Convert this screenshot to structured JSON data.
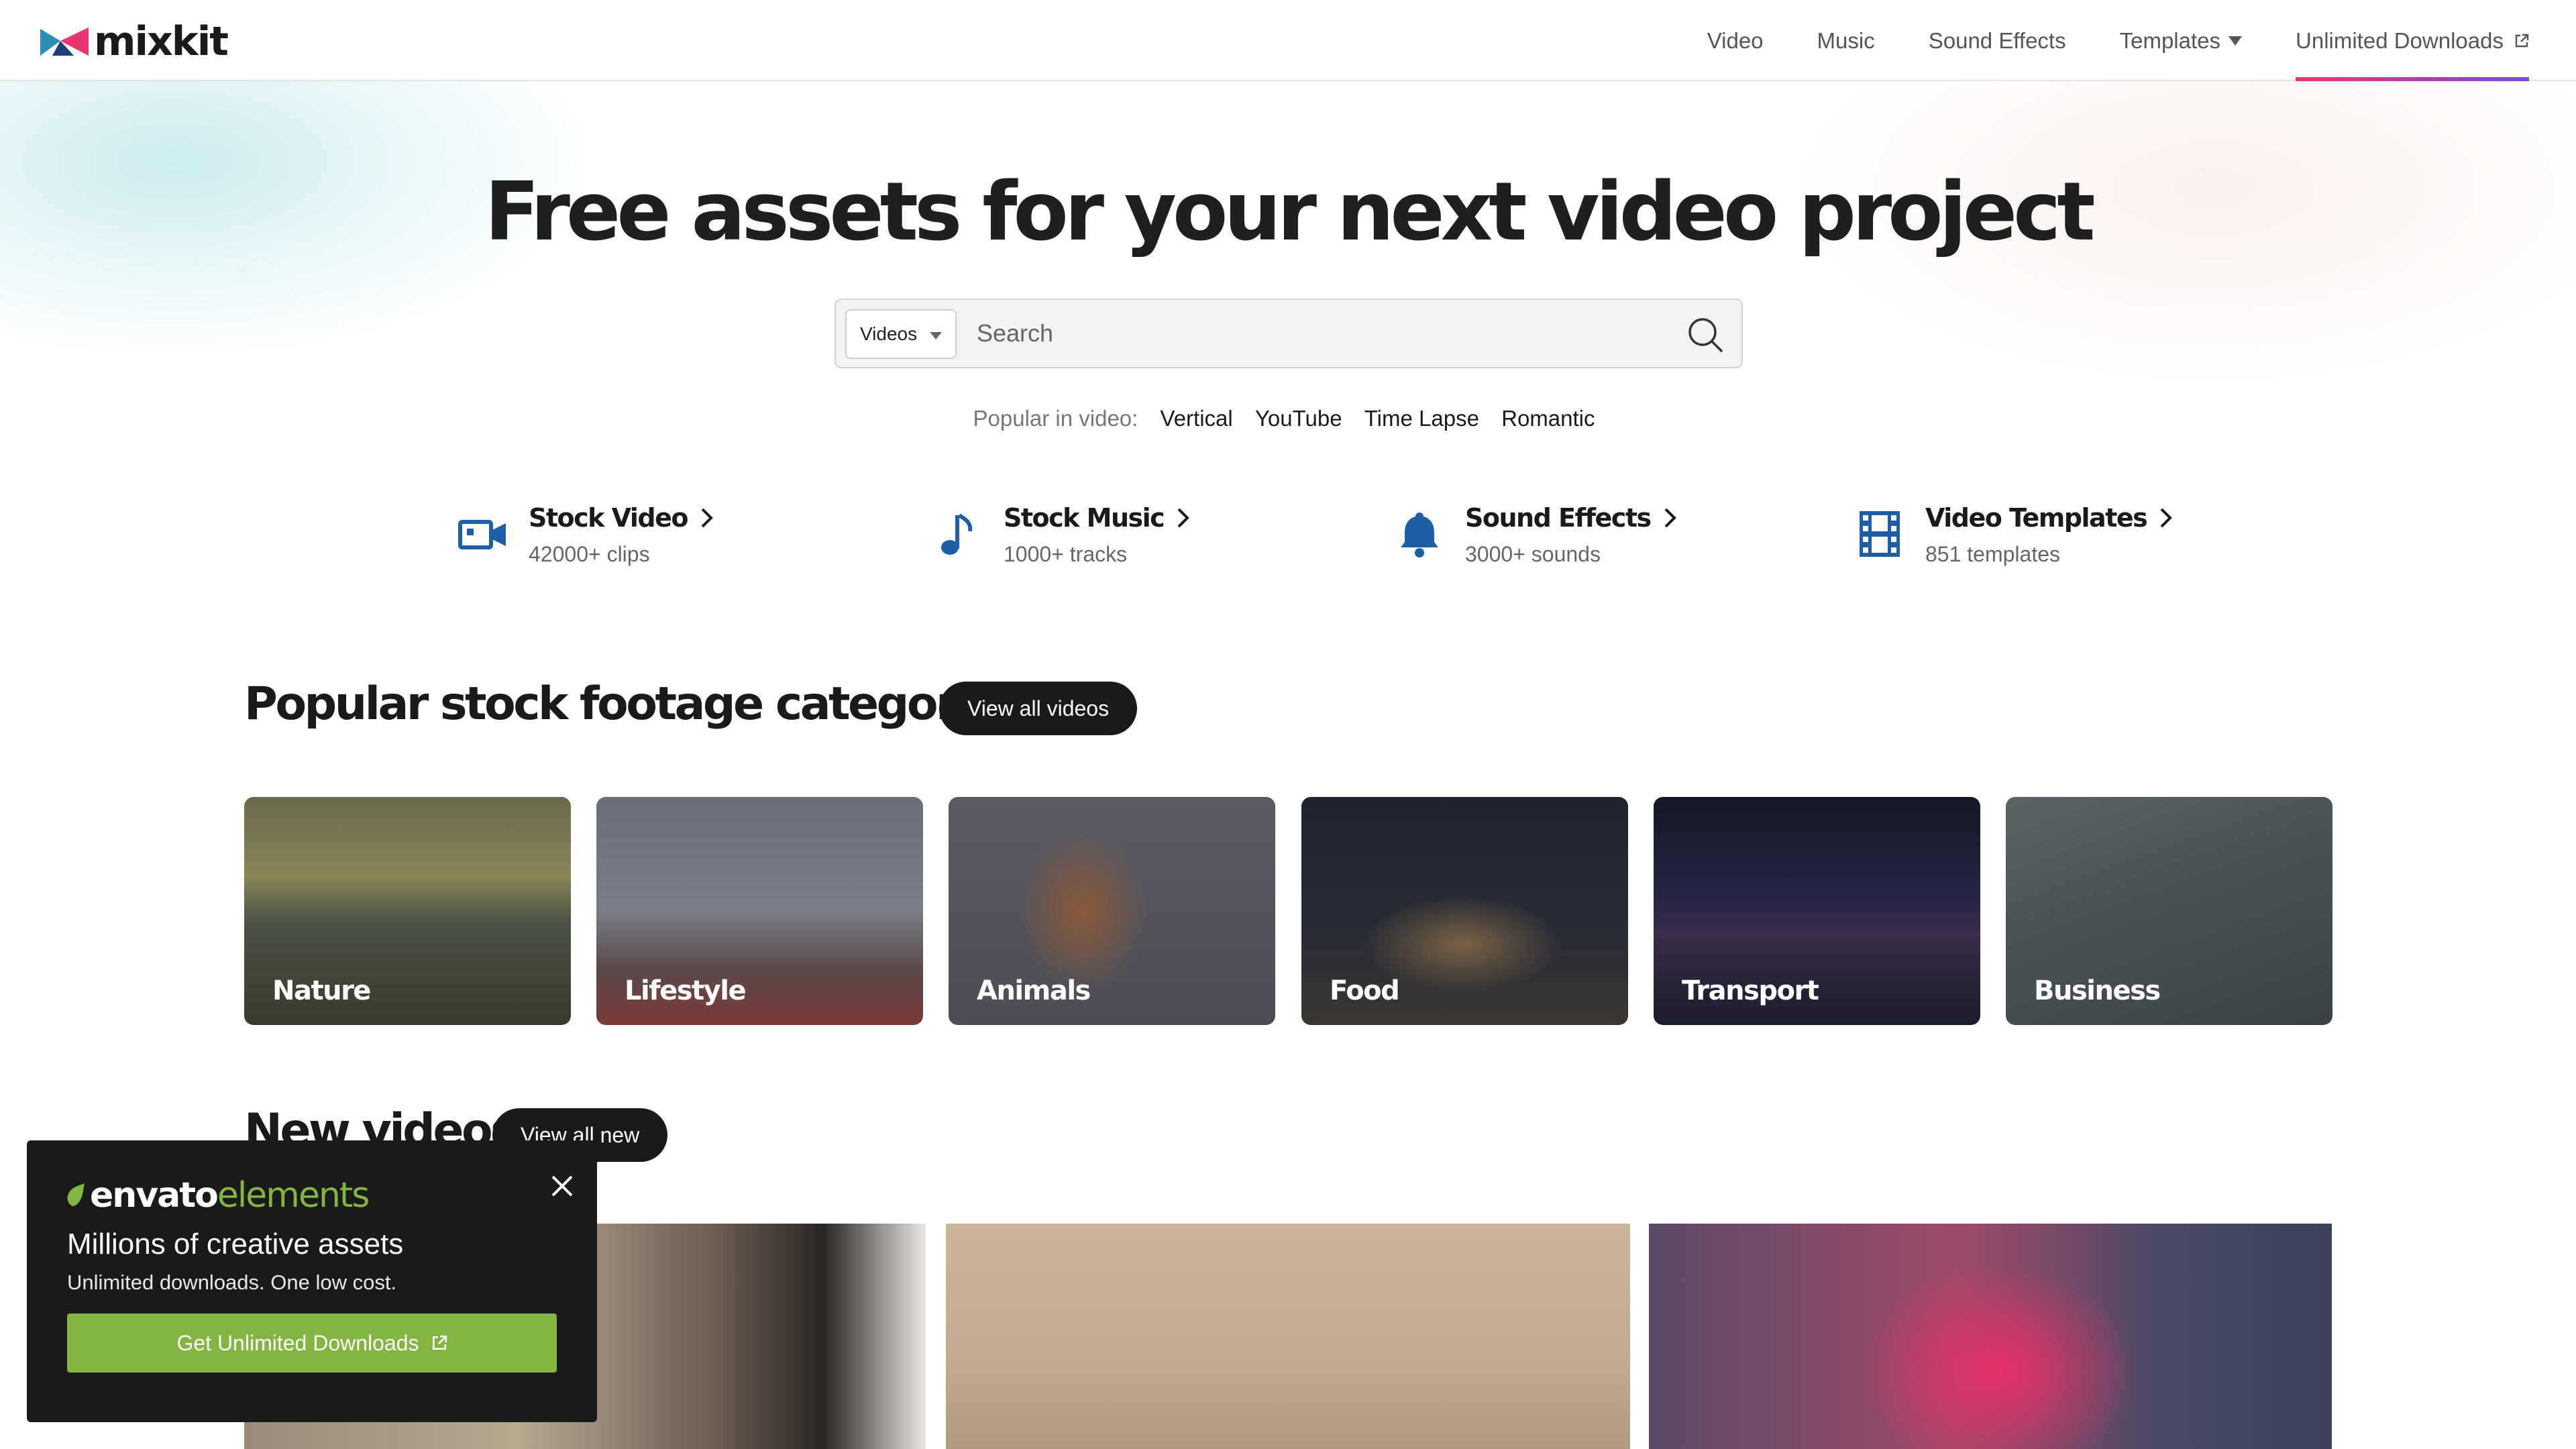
{
  "header": {
    "logo_text": "mixkit",
    "nav": [
      {
        "label": "Video"
      },
      {
        "label": "Music"
      },
      {
        "label": "Sound Effects"
      },
      {
        "label": "Templates"
      },
      {
        "label": "Unlimited Downloads"
      }
    ]
  },
  "hero": {
    "title": "Free assets for your next video project",
    "search": {
      "category": "Videos",
      "placeholder": "Search",
      "value": ""
    },
    "popular_label": "Popular in video:",
    "popular_tags": [
      "Vertical",
      "YouTube",
      "Time Lapse",
      "Romantic"
    ]
  },
  "categories": [
    {
      "title": "Stock Video",
      "subtitle": "42000+ clips",
      "icon": "video-camera-icon"
    },
    {
      "title": "Stock Music",
      "subtitle": "1000+ tracks",
      "icon": "music-note-icon"
    },
    {
      "title": "Sound Effects",
      "subtitle": "3000+ sounds",
      "icon": "bell-icon"
    },
    {
      "title": "Video Templates",
      "subtitle": "851 templates",
      "icon": "film-strip-icon"
    }
  ],
  "popular_section": {
    "title": "Popular stock footage categories",
    "button": "View all videos",
    "cards": [
      {
        "label": "Nature"
      },
      {
        "label": "Lifestyle"
      },
      {
        "label": "Animals"
      },
      {
        "label": "Food"
      },
      {
        "label": "Transport"
      },
      {
        "label": "Business"
      }
    ]
  },
  "new_section": {
    "title": "New videos",
    "button": "View all new"
  },
  "promo": {
    "logo_word1": "envato",
    "logo_word2": "elements",
    "heading": "Millions of creative assets",
    "subheading": "Unlimited downloads. One low cost.",
    "button": "Get Unlimited Downloads"
  },
  "colors": {
    "accent_gradient_start": "#e8346f",
    "accent_gradient_end": "#7a4be0",
    "category_icon_blue": "#1f5fa8",
    "envato_green": "#82b541",
    "dark": "#1a1a1a"
  }
}
